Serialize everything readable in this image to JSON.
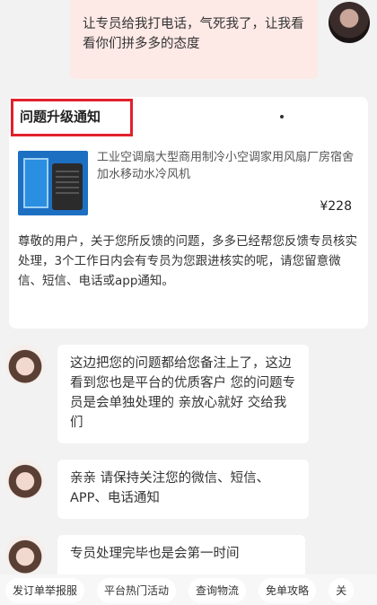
{
  "outgoing": {
    "text": "让专员给我打电话，气死我了，让我看看你们拼多多的态度"
  },
  "card": {
    "title": "问题升级通知",
    "product": {
      "name": "工业空调扇大型商用制冷小空调家用风扇厂房宿舍加水移动水冷风机",
      "price": "¥228"
    },
    "message": "尊敬的用户，关于您所反馈的问题，多多已经帮您反馈专员核实处理，3个工作日内会有专员为您跟进核实的呢，请您留意微信、短信、电话或app通知。"
  },
  "incoming": [
    {
      "text": "这边把您的问题都给您备注上了，这边看到您也是平台的优质客户 您的问题专员是会单独处理的 亲放心就好 交给我们"
    },
    {
      "text": "亲亲 请保持关注您的微信、短信、APP、电话通知"
    },
    {
      "text": "专员处理完毕也是会第一时间"
    }
  ],
  "quick_bar": [
    "发订单举报服",
    "平台热门活动",
    "查询物流",
    "免单攻略",
    "关"
  ]
}
